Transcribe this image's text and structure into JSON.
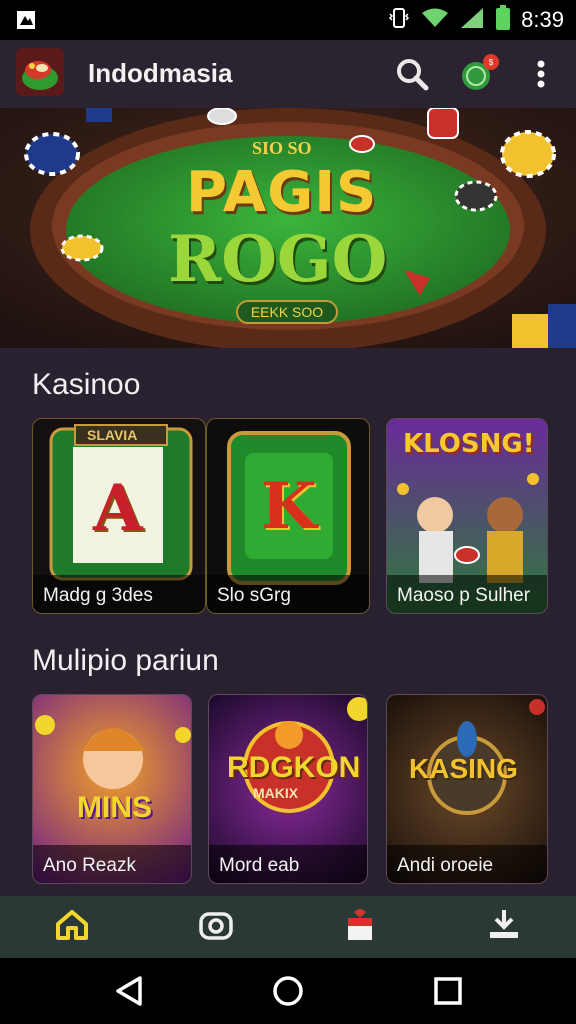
{
  "status_bar": {
    "time": "8:39",
    "icons": [
      "notification-icon",
      "vibrate-icon",
      "wifi-icon",
      "signal-icon",
      "battery-icon"
    ]
  },
  "app_bar": {
    "title": "Indodmasia",
    "icons": [
      "app-logo",
      "search-icon",
      "coin-badge-icon",
      "more-vert-icon"
    ]
  },
  "hero": {
    "line1": "PAGIS",
    "line2": "ROGO",
    "top_text": "SIO SO",
    "button_label": "EEKK SOO"
  },
  "sections": [
    {
      "title": "Kasinoo",
      "cards": [
        {
          "label": "Madg g 3des",
          "reel_letter": "A",
          "sign": "SLAVIA"
        },
        {
          "label": "Slo sGrg",
          "reel_letter": "K"
        },
        {
          "label": "Maoso p Sulher",
          "art_text": "KLOSNG!"
        }
      ]
    },
    {
      "title": "Mulipio pariun",
      "cards": [
        {
          "label": "Ano Reazk",
          "art_text": "MINS"
        },
        {
          "label": "Mord eab",
          "art_text": "RDGKON",
          "art_sub": "MAKIX"
        },
        {
          "label": "Andi oroeie",
          "art_text": "KASING"
        }
      ]
    }
  ],
  "bottom_nav": {
    "items": [
      "home-icon",
      "camera-icon",
      "gift-icon",
      "download-icon"
    ],
    "active_color": "#f2d62b"
  },
  "system_nav": {
    "items": [
      "back-icon",
      "home-circle-icon",
      "recents-icon"
    ]
  },
  "colors": {
    "accent": "#f2d62b",
    "felt_green": "#2f8a2f",
    "app_bar": "#2c2330",
    "background": "#2a2130"
  }
}
